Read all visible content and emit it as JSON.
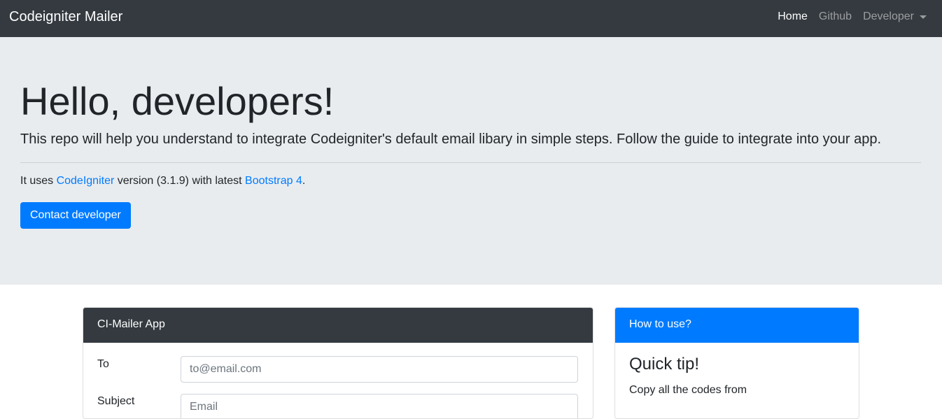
{
  "navbar": {
    "brand": "Codeigniter Mailer",
    "links": [
      {
        "label": "Home"
      },
      {
        "label": "Github"
      },
      {
        "label": "Developer"
      }
    ]
  },
  "jumbotron": {
    "title": "Hello, developers!",
    "lead": "This repo will help you understand to integrate Codeigniter's default email libary in simple steps. Follow the guide to integrate into your app.",
    "info": {
      "prefix": "It uses ",
      "link1": "CodeIgniter",
      "middle": " version (3.1.9) with latest ",
      "link2": "Bootstrap 4",
      "suffix": "."
    },
    "button": "Contact developer"
  },
  "mailer_card": {
    "header": "CI-Mailer App",
    "fields": [
      {
        "label": "To",
        "placeholder": "to@email.com",
        "value": ""
      },
      {
        "label": "Subject",
        "placeholder": "Email",
        "value": ""
      }
    ]
  },
  "howto_card": {
    "header": "How to use?",
    "title": "Quick tip!",
    "text": "Copy all the codes from"
  },
  "colors": {
    "navbar": "#343a40",
    "jumbotron": "#e9ecef",
    "primary": "#007bff"
  }
}
